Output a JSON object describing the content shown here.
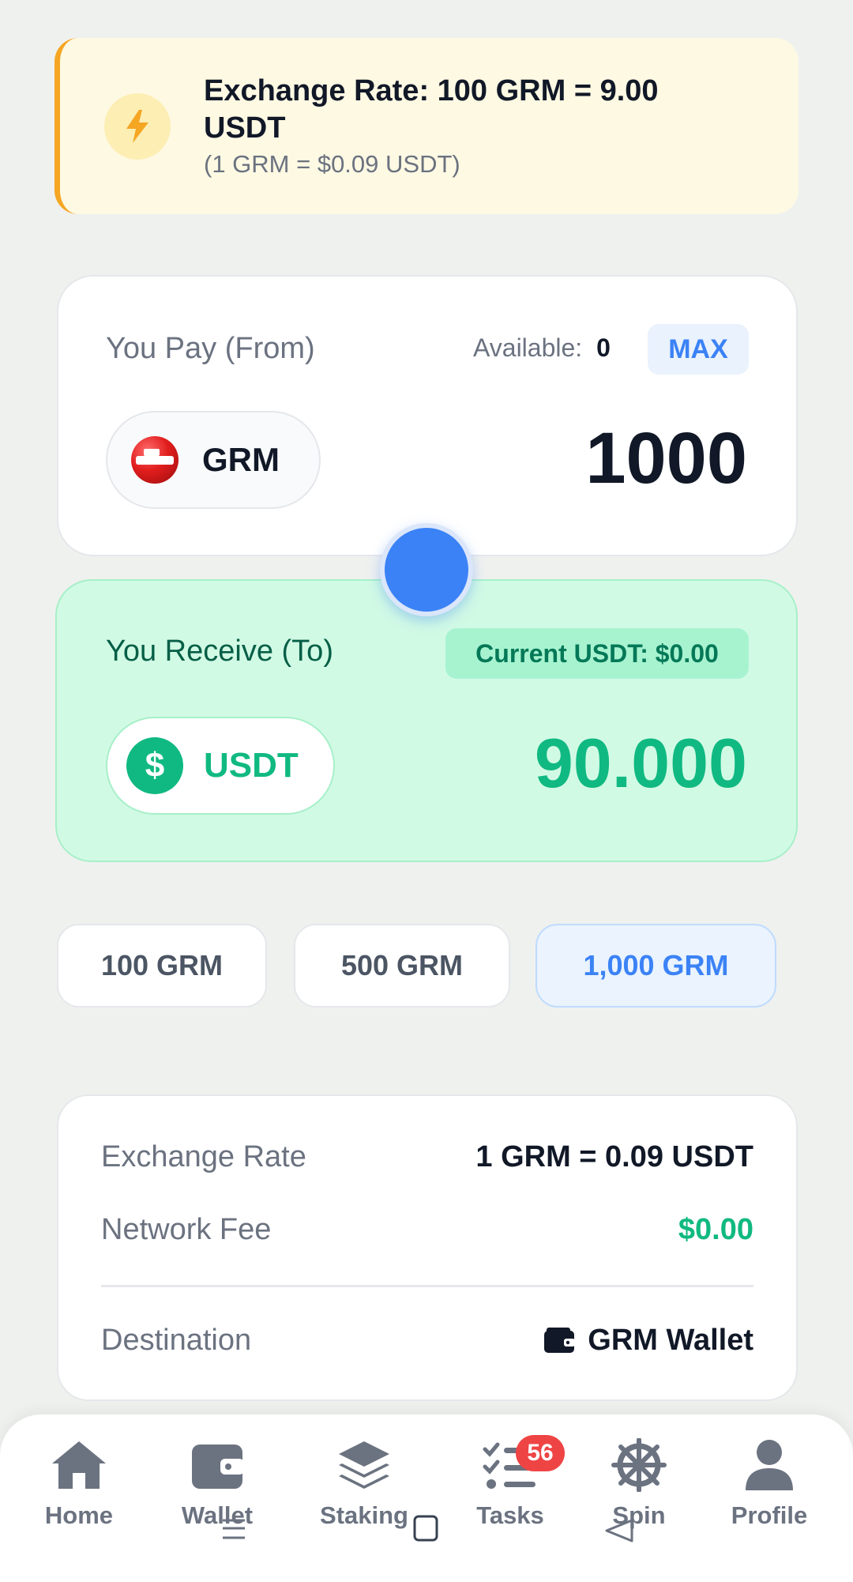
{
  "banner": {
    "title": "Exchange Rate: 100 GRM = 9.00 USDT",
    "subtitle": "(1 GRM = $0.09 USDT)",
    "icon": "lightning-bolt-icon",
    "accent": "#f5a623"
  },
  "pay": {
    "label": "You Pay (From)",
    "available_label": "Available:",
    "available_value": "0",
    "max_label": "MAX",
    "token": "GRM",
    "amount": "1000"
  },
  "receive": {
    "label": "You Receive (To)",
    "current_badge": "Current USDT: $0.00",
    "token": "USDT",
    "token_symbol": "$",
    "amount": "90.000"
  },
  "quick_amounts": [
    "100 GRM",
    "500 GRM",
    "1,000 GRM"
  ],
  "quick_selected": "1,000 GRM",
  "details": {
    "rate_label": "Exchange Rate",
    "rate_value": "1 GRM = 0.09 USDT",
    "fee_label": "Network Fee",
    "fee_value": "$0.00",
    "destination_label": "Destination",
    "destination_value": "GRM Wallet"
  },
  "nav": {
    "items": [
      {
        "label": "Home",
        "icon": "home-icon"
      },
      {
        "label": "Wallet",
        "icon": "wallet-icon"
      },
      {
        "label": "Staking",
        "icon": "layers-icon"
      },
      {
        "label": "Tasks",
        "icon": "tasks-icon",
        "badge": "56"
      },
      {
        "label": "Spin",
        "icon": "wheel-icon"
      },
      {
        "label": "Profile",
        "icon": "user-icon"
      }
    ]
  },
  "colors": {
    "primary": "#3b82f6",
    "success": "#10b981",
    "danger": "#ef4444"
  }
}
